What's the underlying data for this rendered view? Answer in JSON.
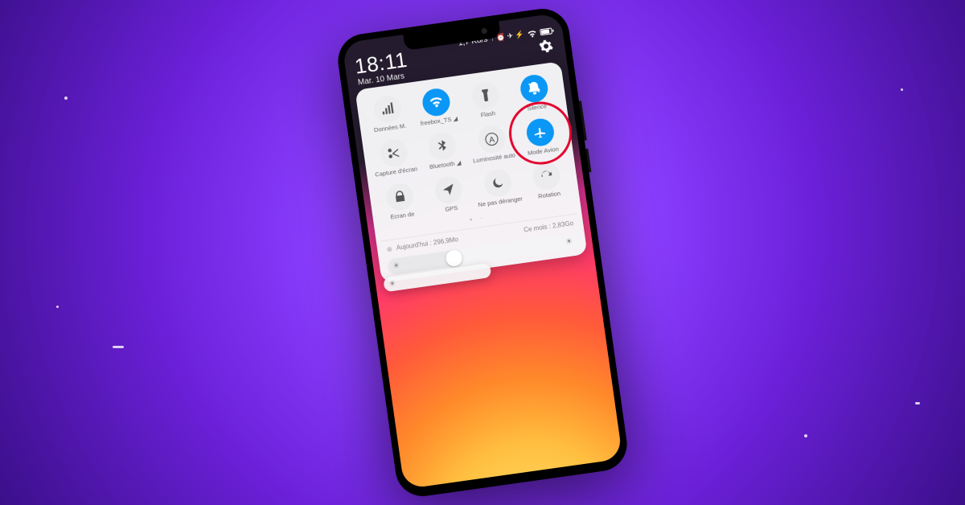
{
  "status": {
    "time": "18:11",
    "date": "Mar. 10 Mars",
    "net_speed": "1,7 Ko/s",
    "indicators": "↑ ⏰ ✈ ⚡",
    "wifi_icon": "wifi",
    "battery_icon": "battery"
  },
  "settings_icon_label": "settings",
  "tiles": [
    {
      "id": "mobile-data",
      "label": "Données M.",
      "icon": "signal",
      "active": false
    },
    {
      "id": "wifi",
      "label": "freebox_TS ◢",
      "icon": "wifi",
      "active": true
    },
    {
      "id": "flash",
      "label": "Flash",
      "icon": "flashlight",
      "active": false
    },
    {
      "id": "silence",
      "label": "Silence",
      "icon": "mute",
      "active": true
    },
    {
      "id": "screenshot",
      "label": "Capture d'écran",
      "icon": "scissors",
      "active": false
    },
    {
      "id": "bluetooth",
      "label": "Bluetooth ◢",
      "icon": "bluetooth",
      "active": false
    },
    {
      "id": "auto-bright",
      "label": "Luminosité auto",
      "icon": "auto-bright",
      "active": false
    },
    {
      "id": "airplane",
      "label": "Mode Avion",
      "icon": "airplane",
      "active": true
    },
    {
      "id": "lockscreen",
      "label": "Écran de",
      "icon": "lock",
      "active": false
    },
    {
      "id": "gps",
      "label": "GPS",
      "icon": "location",
      "active": false
    },
    {
      "id": "dnd",
      "label": "Ne pas déranger",
      "icon": "moon",
      "active": false
    },
    {
      "id": "rotation",
      "label": "Rotation",
      "icon": "rotate",
      "active": false
    }
  ],
  "page_indicator": "• ·",
  "data_usage": {
    "today_label": "Aujourd'hui",
    "today_value": "296,9Mo",
    "month_label": "Ce mois",
    "month_value": "2,83Go"
  },
  "brightness": {
    "level_pct": 35
  },
  "highlight_target": "airplane",
  "colors": {
    "accent": "#0a97f5",
    "highlight": "#e3002b"
  }
}
